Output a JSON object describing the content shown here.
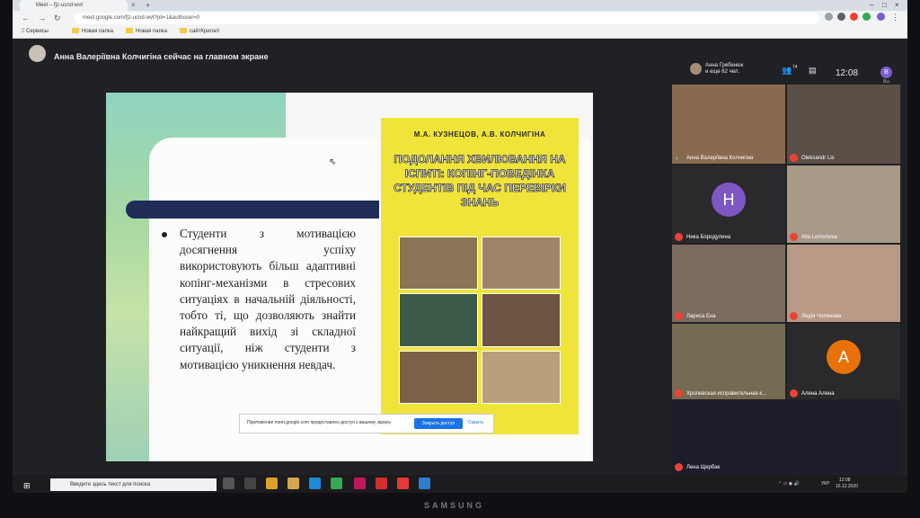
{
  "browser": {
    "tab_title": "Meet – fjz-ucnd-wvt",
    "url": "meet.google.com/fjz-ucnd-wvt?pli=1&authuser=0",
    "bookmarks": [
      "Сервисы",
      "Новая папка",
      "Новая папка",
      "сайтКрилаті"
    ]
  },
  "meet": {
    "presenter_text": "Анна Валеріївна Колчигіна сейчас на главном экране",
    "participants_name": "Анна Гребенюк",
    "participants_more": "и еще 62 чел.",
    "participant_count": "74",
    "clock": "12:08",
    "user_initial": "В",
    "you_label": "Вы"
  },
  "slide": {
    "bullet": "Студенти з мотивацією досягнення успіху використовують більш адаптивні копінг-механізми в стресових ситуаціях в начальній діяльності, тобто ті, що дозволяють знайти найкращий вихід зі складної ситуації, ніж студенти з мотивацією уникнення невдач.",
    "book_authors": "М.А. КУЗНЕЦОВ, А.В. КОЛЧИГІНА",
    "book_title": "ПОДОЛАННЯ ХВИЛЮВАННЯ НА ІСПИТІ: КОПІНГ-ПОВЕДІНКА СТУДЕНТІВ ПІД ЧАС ПЕРЕВІРКИ ЗНАНЬ"
  },
  "share_bar": {
    "text": "Приложение meet.google.com предоставлен доступ к вашему экрану",
    "stop_label": "Закрыть доступ",
    "hide_label": "Скрыть"
  },
  "tiles": [
    {
      "name": "Анна Валеріївна Колчигіна",
      "mic": "on",
      "bg": "#8a6a4e"
    },
    {
      "name": "Oleksandr Lis",
      "mic": "off",
      "bg": "#5a5048"
    },
    {
      "name": "Ника Бородулина",
      "mic": "off",
      "initial": "Н",
      "bg": "#2a2a2d",
      "avatar": "#7e57c2"
    },
    {
      "name": "Alla Lemonova",
      "mic": "off",
      "bg": "#a89888"
    },
    {
      "name": "Лариса Ена",
      "mic": "off",
      "bg": "#7b6a5f"
    },
    {
      "name": "Лидія Чопенова",
      "mic": "off",
      "bg": "#b99a86"
    },
    {
      "name": "Хролевская исправительная к...",
      "mic": "off",
      "bg": "#756a52"
    },
    {
      "name": "Алена Алена",
      "mic": "off",
      "initial": "А",
      "bg": "#2a2a2d",
      "avatar": "#e8710a"
    },
    {
      "name": "Лена Щербак",
      "mic": "off",
      "bg": "#1d1c2b"
    }
  ],
  "taskbar": {
    "search_placeholder": "Введите здесь текст для поиска",
    "lang": "УКР",
    "time": "12:08",
    "date": "16.12.2020"
  },
  "monitor_brand": "SAMSUNG"
}
